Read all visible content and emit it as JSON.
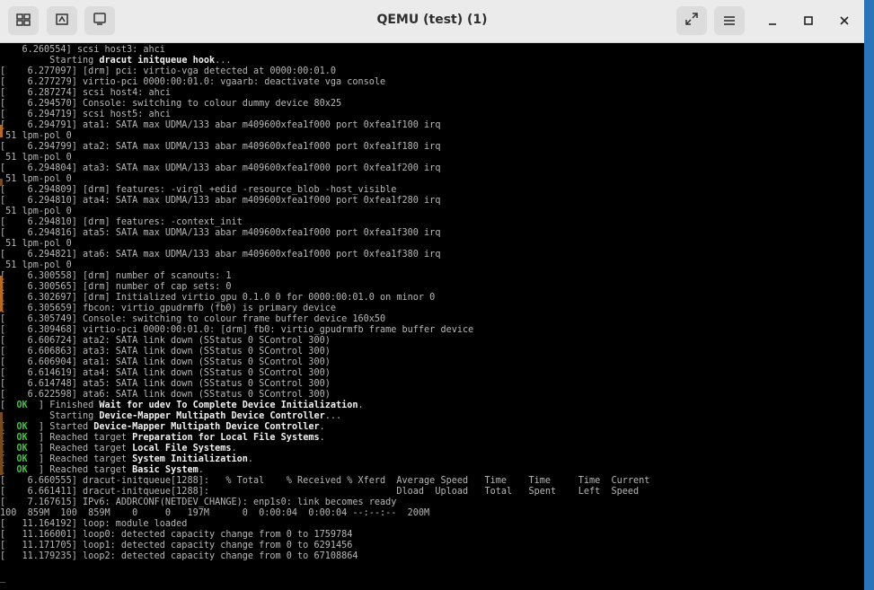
{
  "window": {
    "title": "QEMU (test) (1)"
  },
  "terminal": {
    "lines": [
      {
        "t": "    6.260554] scsi host3: ahci"
      },
      {
        "t": "         Starting ",
        "h": "dracut initqueue hook",
        "r": "..."
      },
      {
        "t": "[    6.277097] [drm] pci: virtio-vga detected at 0000:00:01.0"
      },
      {
        "t": "[    6.277279] virtio-pci 0000:00:01.0: vgaarb: deactivate vga console"
      },
      {
        "t": "[    6.287274] scsi host4: ahci"
      },
      {
        "t": "[    6.294570] Console: switching to colour dummy device 80x25"
      },
      {
        "t": "[    6.294719] scsi host5: ahci"
      },
      {
        "t": "[    6.294791] ata1: SATA max UDMA/133 abar m409600xfea1f000 port 0xfea1f100 irq"
      },
      {
        "t": " 51 lpm-pol 0"
      },
      {
        "t": "[    6.294799] ata2: SATA max UDMA/133 abar m409600xfea1f000 port 0xfea1f180 irq"
      },
      {
        "t": " 51 lpm-pol 0"
      },
      {
        "t": "[    6.294804] ata3: SATA max UDMA/133 abar m409600xfea1f000 port 0xfea1f200 irq"
      },
      {
        "t": " 51 lpm-pol 0"
      },
      {
        "t": "[    6.294809] [drm] features: -virgl +edid -resource_blob -host_visible"
      },
      {
        "t": "[    6.294810] ata4: SATA max UDMA/133 abar m409600xfea1f000 port 0xfea1f280 irq"
      },
      {
        "t": " 51 lpm-pol 0"
      },
      {
        "t": "[    6.294810] [drm] features: -context_init"
      },
      {
        "t": "[    6.294816] ata5: SATA max UDMA/133 abar m409600xfea1f000 port 0xfea1f300 irq"
      },
      {
        "t": " 51 lpm-pol 0"
      },
      {
        "t": "[    6.294821] ata6: SATA max UDMA/133 abar m409600xfea1f000 port 0xfea1f380 irq"
      },
      {
        "t": " 51 lpm-pol 0"
      },
      {
        "t": "[    6.300558] [drm] number of scanouts: 1"
      },
      {
        "t": "[    6.300565] [drm] number of cap sets: 0"
      },
      {
        "t": "[    6.302697] [drm] Initialized virtio_gpu 0.1.0 0 for 0000:00:01.0 on minor 0"
      },
      {
        "t": "[    6.305659] fbcon: virtio_gpudrmfb (fb0) is primary device"
      },
      {
        "t": "[    6.305749] Console: switching to colour frame buffer device 160x50"
      },
      {
        "t": "[    6.309468] virtio-pci 0000:00:01.0: [drm] fb0: virtio_gpudrmfb frame buffer device"
      },
      {
        "t": "[    6.606724] ata2: SATA link down (SStatus 0 SControl 300)"
      },
      {
        "t": "[    6.606863] ata3: SATA link down (SStatus 0 SControl 300)"
      },
      {
        "t": "[    6.606904] ata1: SATA link down (SStatus 0 SControl 300)"
      },
      {
        "t": "[    6.614619] ata4: SATA link down (SStatus 0 SControl 300)"
      },
      {
        "t": "[    6.614748] ata5: SATA link down (SStatus 0 SControl 300)"
      },
      {
        "t": "[    6.622598] ata6: SATA link down (SStatus 0 SControl 300)"
      },
      {
        "p": "[  ",
        "ok": "OK",
        "t": "  ] Finished ",
        "h": "Wait for udev To Complete Device Initialization",
        "r": "."
      },
      {
        "t": "         Starting ",
        "h": "Device-Mapper Multipath Device Controller",
        "r": "..."
      },
      {
        "p": "[  ",
        "ok": "OK",
        "t": "  ] Started ",
        "h": "Device-Mapper Multipath Device Controller",
        "r": "."
      },
      {
        "p": "[  ",
        "ok": "OK",
        "t": "  ] Reached target ",
        "h": "Preparation for Local File Systems",
        "r": "."
      },
      {
        "p": "[  ",
        "ok": "OK",
        "t": "  ] Reached target ",
        "h": "Local File Systems",
        "r": "."
      },
      {
        "p": "[  ",
        "ok": "OK",
        "t": "  ] Reached target ",
        "h": "System Initialization",
        "r": "."
      },
      {
        "p": "[  ",
        "ok": "OK",
        "t": "  ] Reached target ",
        "h": "Basic System",
        "r": "."
      },
      {
        "t": "[    6.660555] dracut-initqueue[1288]:   % Total    % Received % Xferd  Average Speed   Time    Time     Time  Current"
      },
      {
        "t": "[    6.661411] dracut-initqueue[1288]:                                  Dload  Upload   Total   Spent    Left  Speed"
      },
      {
        "t": "[    7.167615] IPv6: ADDRCONF(NETDEV_CHANGE): enp1s0: link becomes ready"
      },
      {
        "t": "100  859M  100  859M    0     0   197M      0  0:00:04  0:00:04 --:--:--  200M"
      },
      {
        "t": "[   11.164192] loop: module loaded"
      },
      {
        "t": "[   11.166001] loop0: detected capacity change from 0 to 1759784"
      },
      {
        "t": "[   11.171705] loop1: detected capacity change from 0 to 6291456"
      },
      {
        "t": "[   11.179235] loop2: detected capacity change from 0 to 67108864"
      },
      {
        "t": ""
      },
      {
        "t": "_"
      }
    ]
  },
  "icons": {
    "tabs": "sidebar-tabs-icon",
    "screenshot": "screenshot-icon",
    "display": "display-icon",
    "fullscreen": "fullscreen-icon",
    "menu": "hamburger-menu-icon",
    "minimize": "minimize-icon",
    "maximize": "maximize-icon",
    "close": "close-icon"
  },
  "colors": {
    "ok": "#3fc43f",
    "titlebar": "#ebebeb",
    "terminal_bg": "#000000"
  }
}
